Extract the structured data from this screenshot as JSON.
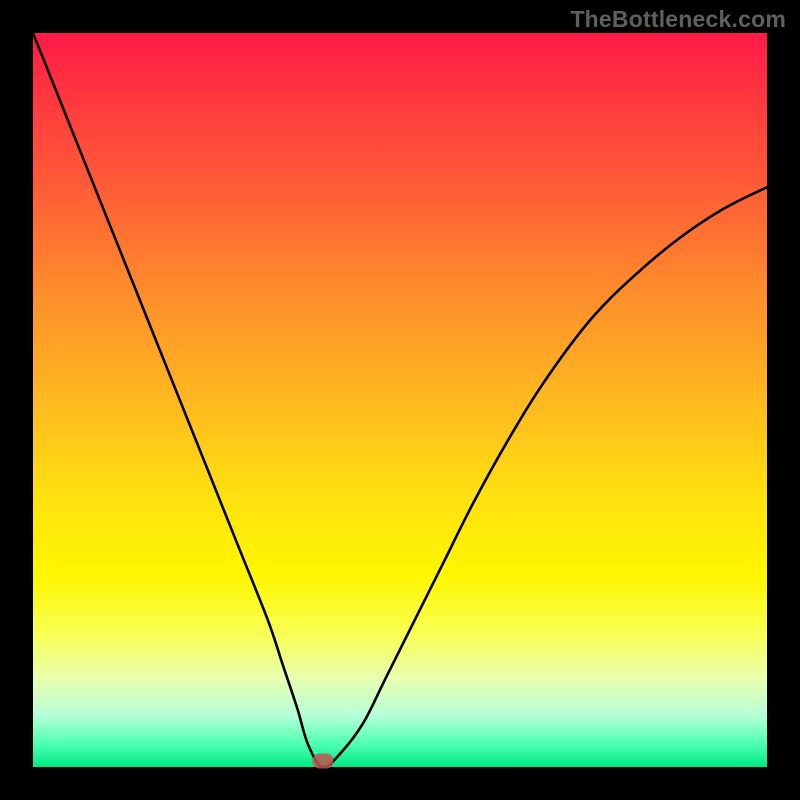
{
  "watermark": "TheBottleneck.com",
  "marker": {
    "x_fraction": 0.395,
    "y_fraction": 0.992
  },
  "chart_data": {
    "type": "line",
    "title": "",
    "xlabel": "",
    "ylabel": "",
    "xlim": [
      0,
      100
    ],
    "ylim": [
      0,
      100
    ],
    "series": [
      {
        "name": "bottleneck-curve",
        "x": [
          0,
          4,
          8,
          12,
          16,
          20,
          24,
          28,
          32,
          34,
          36,
          37.5,
          39.5,
          42,
          45,
          48,
          52,
          56,
          60,
          65,
          70,
          76,
          82,
          88,
          94,
          100
        ],
        "y": [
          100,
          90,
          80,
          70,
          60,
          50,
          40,
          30,
          20,
          14,
          8,
          3,
          0,
          2,
          6,
          12,
          20,
          28,
          36,
          45,
          53,
          61,
          67,
          72,
          76,
          79
        ]
      }
    ],
    "marker_point": {
      "x": 39.5,
      "y": 0.8
    }
  }
}
